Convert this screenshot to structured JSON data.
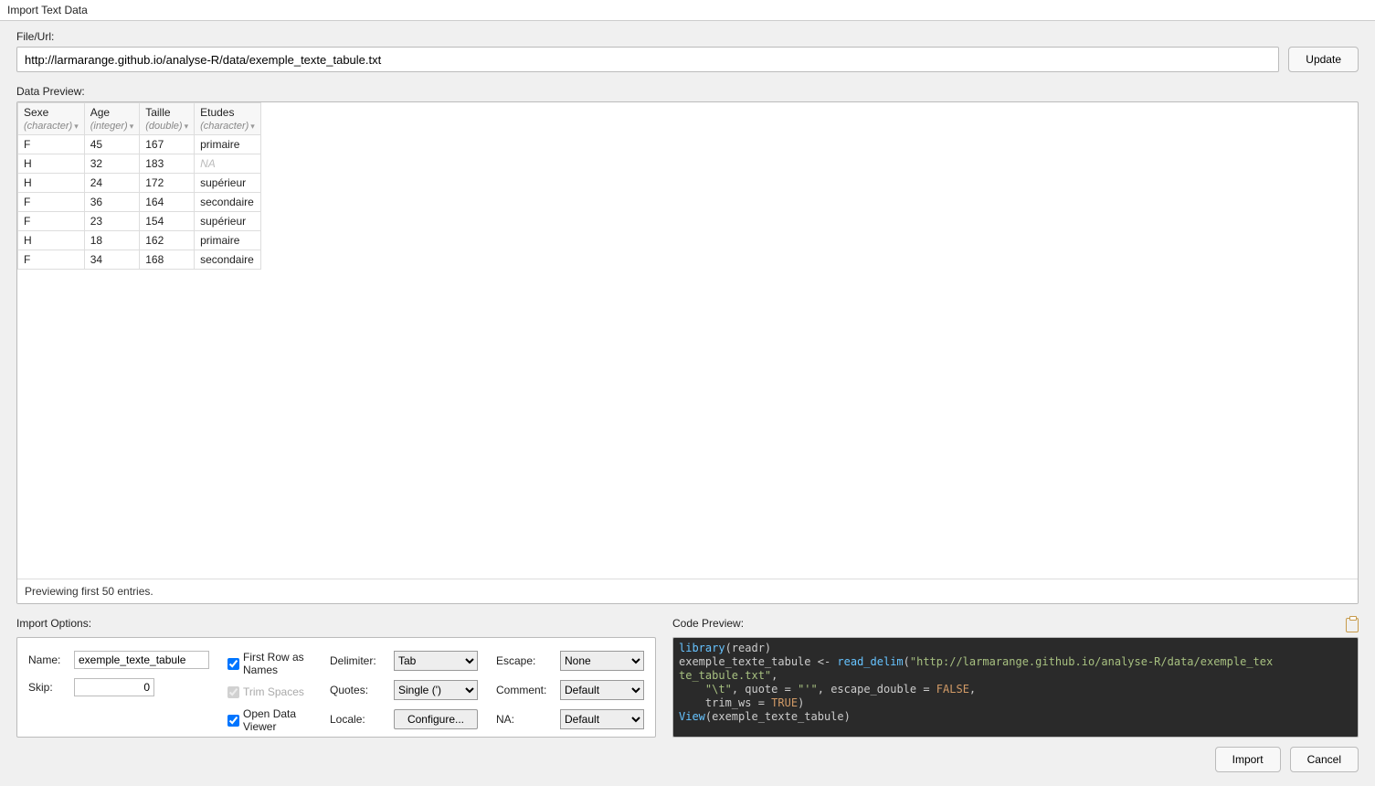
{
  "window": {
    "title": "Import Text Data"
  },
  "file": {
    "label": "File/Url:",
    "value": "http://larmarange.github.io/analyse-R/data/exemple_texte_tabule.txt",
    "update_btn": "Update"
  },
  "preview": {
    "label": "Data Preview:",
    "columns": [
      {
        "name": "Sexe",
        "type": "(character)"
      },
      {
        "name": "Age",
        "type": "(integer)"
      },
      {
        "name": "Taille",
        "type": "(double)"
      },
      {
        "name": "Etudes",
        "type": "(character)"
      }
    ],
    "rows": [
      {
        "sexe": "F",
        "age": "45",
        "taille": "167",
        "etudes": "primaire"
      },
      {
        "sexe": "H",
        "age": "32",
        "taille": "183",
        "etudes": "NA",
        "na": true
      },
      {
        "sexe": "H",
        "age": "24",
        "taille": "172",
        "etudes": "supérieur"
      },
      {
        "sexe": "F",
        "age": "36",
        "taille": "164",
        "etudes": "secondaire"
      },
      {
        "sexe": "F",
        "age": "23",
        "taille": "154",
        "etudes": "supérieur"
      },
      {
        "sexe": "H",
        "age": "18",
        "taille": "162",
        "etudes": "primaire"
      },
      {
        "sexe": "F",
        "age": "34",
        "taille": "168",
        "etudes": "secondaire"
      }
    ],
    "footer": "Previewing first 50 entries."
  },
  "options": {
    "label": "Import Options:",
    "name_label": "Name:",
    "name_value": "exemple_texte_tabule",
    "skip_label": "Skip:",
    "skip_value": "0",
    "first_row": "First Row as Names",
    "trim_spaces": "Trim Spaces",
    "open_viewer": "Open Data Viewer",
    "delimiter_label": "Delimiter:",
    "delimiter_value": "Tab",
    "quotes_label": "Quotes:",
    "quotes_value": "Single (')",
    "locale_label": "Locale:",
    "locale_btn": "Configure...",
    "escape_label": "Escape:",
    "escape_value": "None",
    "comment_label": "Comment:",
    "comment_value": "Default",
    "na_label": "NA:",
    "na_value": "Default"
  },
  "code": {
    "label": "Code Preview:",
    "l1a": "library",
    "l1b": "(readr)",
    "l2a": "exemple_texte_tabule <- ",
    "l2fn": "read_delim",
    "l2b": "(",
    "l2str": "\"http://larmarange.github.io/analyse-R/data/exemple_tex",
    "l3str": "te_tabule.txt\"",
    "l3b": ", ",
    "l4a": "    ",
    "l4s1": "\"\\t\"",
    "l4b": ", quote = ",
    "l4s2": "\"'\"",
    "l4c": ", escape_double = ",
    "l4k": "FALSE",
    "l4d": ", ",
    "l5a": "    trim_ws = ",
    "l5k": "TRUE",
    "l5b": ")",
    "l6a": "View",
    "l6b": "(exemple_texte_tabule)"
  },
  "footer": {
    "import": "Import",
    "cancel": "Cancel"
  }
}
